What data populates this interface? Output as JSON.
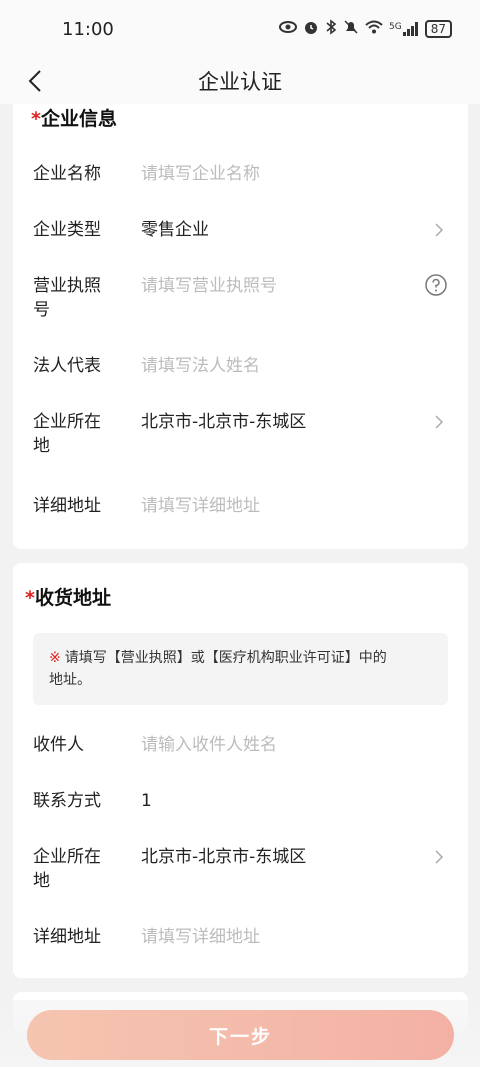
{
  "status_bar": {
    "time": "11:00",
    "signal_label": "5G",
    "battery": "87"
  },
  "header": {
    "title": "企业认证"
  },
  "company_info": {
    "required_mark": "*",
    "title": "企业信息",
    "fields": {
      "name": {
        "label": "企业名称",
        "placeholder": "请填写企业名称"
      },
      "type": {
        "label": "企业类型",
        "value": "零售企业"
      },
      "license": {
        "label_line1": "营业执照",
        "label_line2": "号",
        "placeholder": "请填写营业执照号"
      },
      "legal_rep": {
        "label": "法人代表",
        "placeholder": "请填写法人姓名"
      },
      "location": {
        "label_line1": "企业所在",
        "label_line2": "地",
        "value": "北京市-北京市-东城区"
      },
      "address": {
        "label": "详细地址",
        "placeholder": "请填写详细地址"
      }
    }
  },
  "shipping": {
    "required_mark": "*",
    "title": "收货地址",
    "notice_mark": "※",
    "notice_line1": "请填写【营业执照】或【医疗机构职业许可证】中的",
    "notice_line2": "地址。",
    "fields": {
      "recipient": {
        "label": "收件人",
        "placeholder": "请输入收件人姓名"
      },
      "contact": {
        "label": "联系方式",
        "value": "1"
      },
      "location": {
        "label_line1": "企业所在",
        "label_line2": "地",
        "value": "北京市-北京市-东城区"
      },
      "address": {
        "label": "详细地址",
        "placeholder": "请填写详细地址"
      }
    }
  },
  "footer": {
    "next_label": "下一步"
  }
}
